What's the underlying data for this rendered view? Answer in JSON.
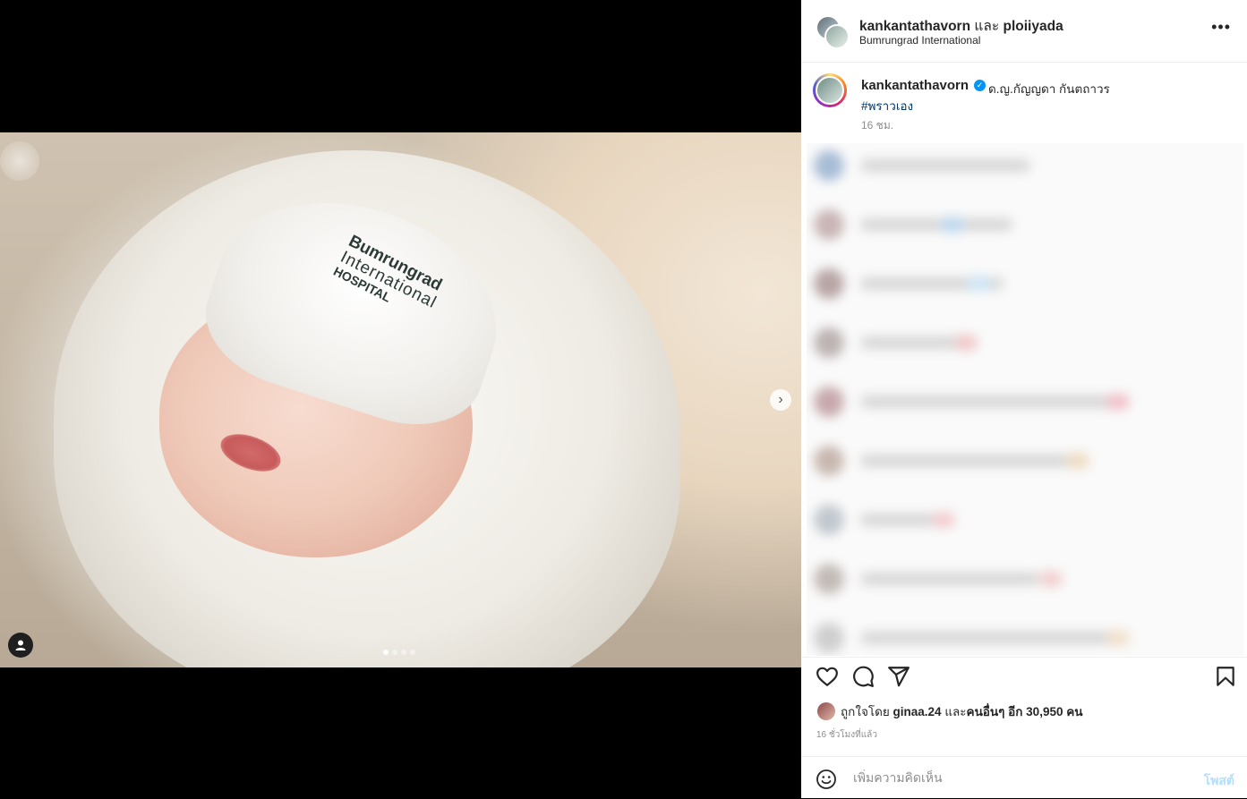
{
  "media": {
    "hat_text_line1": "Bumrungrad",
    "hat_text_line2": "International",
    "hat_text_line3": "HOSPITAL",
    "carousel_dots": 4,
    "active_dot": 0
  },
  "header": {
    "user1": "kankantathavorn",
    "joiner": "และ",
    "user2": "ploiiyada",
    "location": "Bumrungrad International",
    "more_icon": "more-horizontal-icon"
  },
  "caption": {
    "username": "kankantathavorn",
    "verified_icon": "verified-badge-icon",
    "text": "ด.ญ.กัญญดา กันตถาวร",
    "hashtag": "#พราวเอง",
    "time": "16 ชม."
  },
  "comments": {
    "blurred": true
  },
  "actions": {
    "like_icon": "heart-icon",
    "comment_icon": "comment-icon",
    "share_icon": "send-icon",
    "save_icon": "bookmark-icon"
  },
  "likes": {
    "prefix": "ถูกใจโดย ",
    "user": "ginaa.24",
    "middle": " และ",
    "others": "คนอื่นๆ อีก 30,950 คน"
  },
  "timestamp": "16 ชั่วโมงที่แล้ว",
  "add_comment": {
    "placeholder": "เพิ่มความคิดเห็น",
    "post_label": "โพสต์",
    "emoji_icon": "emoji-icon"
  },
  "colors": {
    "link": "#00376b",
    "verified": "#0095f6",
    "post_disabled": "#b2dffc"
  }
}
